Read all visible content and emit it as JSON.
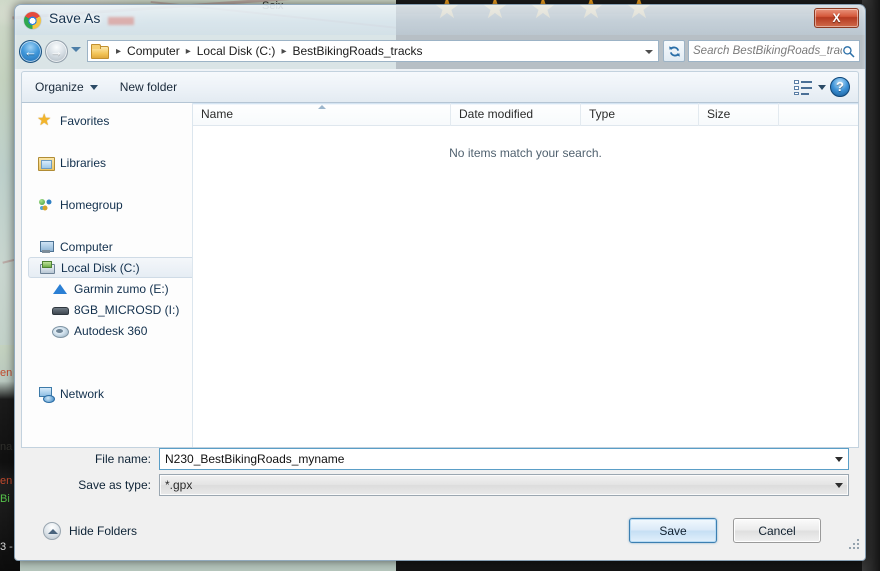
{
  "background": {
    "map_label": "Seix",
    "star_count": 5,
    "star_glyph": "★",
    "left_strip_texts": [
      "en",
      "na",
      "en",
      "Bi",
      "3 -"
    ]
  },
  "window": {
    "title": "Save As",
    "app_icon": "chrome-icon",
    "close_label": "X"
  },
  "navigation": {
    "back_glyph": "←",
    "forward_glyph": "→",
    "history_dropdown": "chevron-down-icon",
    "breadcrumb": [
      "Computer",
      "Local Disk (C:)",
      "BestBikingRoads_tracks"
    ],
    "breadcrumb_separator": "▸",
    "address_dropdown": "chevron-down-icon",
    "refresh_glyph": "↻",
    "search": {
      "placeholder": "Search BestBikingRoads_tracks",
      "icon": "search-icon",
      "value": ""
    }
  },
  "toolbar": {
    "organize_label": "Organize",
    "new_folder_label": "New folder",
    "view_icon": "view-layout-icon",
    "view_dropdown": "chevron-down-icon",
    "help_label": "?"
  },
  "nav_pane": {
    "items": [
      {
        "label": "Favorites",
        "icon": "star-icon",
        "level": 0,
        "selected": false
      },
      {
        "label": "Libraries",
        "icon": "library-icon",
        "level": 0,
        "selected": false
      },
      {
        "label": "Homegroup",
        "icon": "homegroup-icon",
        "level": 0,
        "selected": false
      },
      {
        "label": "Computer",
        "icon": "computer-icon",
        "level": 0,
        "selected": false
      },
      {
        "label": "Local Disk (C:)",
        "icon": "harddisk-icon",
        "level": 1,
        "selected": true
      },
      {
        "label": "Garmin zumo (E:)",
        "icon": "device-icon",
        "level": 1,
        "selected": false
      },
      {
        "label": "8GB_MICROSD (I:)",
        "icon": "usb-drive-icon",
        "level": 1,
        "selected": false
      },
      {
        "label": "Autodesk 360",
        "icon": "cloud-icon",
        "level": 1,
        "selected": false
      },
      {
        "label": "Network",
        "icon": "network-icon",
        "level": 0,
        "selected": false
      }
    ]
  },
  "file_list": {
    "columns": [
      {
        "key": "name",
        "label": "Name",
        "sorted": true
      },
      {
        "key": "date",
        "label": "Date modified",
        "sorted": false
      },
      {
        "key": "type",
        "label": "Type",
        "sorted": false
      },
      {
        "key": "size",
        "label": "Size",
        "sorted": false
      }
    ],
    "rows": [],
    "empty_message": "No items match your search.",
    "sort_direction": "ascending"
  },
  "form": {
    "file_name_label": "File name:",
    "file_name_value": "N230_BestBikingRoads_myname",
    "save_as_type_label": "Save as type:",
    "save_as_type_value": "*.gpx"
  },
  "footer": {
    "hide_folders_label": "Hide Folders",
    "save_label": "Save",
    "cancel_label": "Cancel"
  }
}
